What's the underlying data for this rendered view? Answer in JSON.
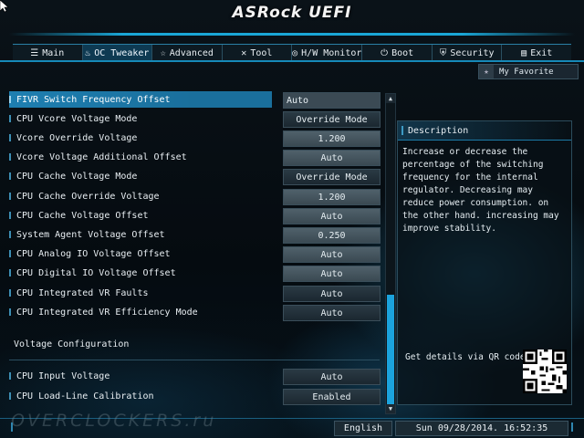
{
  "app": {
    "title": "ASRock UEFI"
  },
  "tabs": [
    {
      "label": "Main",
      "icon": "list-icon",
      "active": false
    },
    {
      "label": "OC Tweaker",
      "icon": "flame-icon",
      "active": true
    },
    {
      "label": "Advanced",
      "icon": "star-icon",
      "active": false
    },
    {
      "label": "Tool",
      "icon": "wrench-icon",
      "active": false
    },
    {
      "label": "H/W Monitor",
      "icon": "monitor-icon",
      "active": false
    },
    {
      "label": "Boot",
      "icon": "power-icon",
      "active": false
    },
    {
      "label": "Security",
      "icon": "shield-icon",
      "active": false
    },
    {
      "label": "Exit",
      "icon": "exit-icon",
      "active": false
    }
  ],
  "favorite": {
    "label": "My Favorite"
  },
  "settings": [
    {
      "label": "FIVR Switch Frequency Offset",
      "value": "Auto"
    },
    {
      "label": "CPU Vcore Voltage Mode",
      "value": "Override Mode"
    },
    {
      "label": "Vcore Override Voltage",
      "value": "1.200"
    },
    {
      "label": "Vcore Voltage Additional Offset",
      "value": "Auto"
    },
    {
      "label": "CPU Cache Voltage Mode",
      "value": "Override Mode"
    },
    {
      "label": "CPU Cache Override Voltage",
      "value": "1.200"
    },
    {
      "label": "CPU Cache Voltage Offset",
      "value": "Auto"
    },
    {
      "label": "System Agent Voltage Offset",
      "value": "0.250"
    },
    {
      "label": "CPU Analog IO Voltage Offset",
      "value": "Auto"
    },
    {
      "label": "CPU Digital IO Voltage Offset",
      "value": "Auto"
    },
    {
      "label": "CPU Integrated VR Faults",
      "value": "Auto"
    },
    {
      "label": "CPU Integrated VR Efficiency Mode",
      "value": "Auto"
    }
  ],
  "section": {
    "label": "Voltage Configuration"
  },
  "settings2": [
    {
      "label": "CPU Input Voltage",
      "value": "Auto"
    },
    {
      "label": "CPU Load-Line Calibration",
      "value": "Enabled"
    }
  ],
  "description": {
    "title": "Description",
    "text": "Increase or decrease the percentage of the switching frequency for the internal regulator. Decreasing may reduce power consumption. on the other hand. increasing may improve stability.",
    "qr_label": "Get details via QR code"
  },
  "footer": {
    "watermark": "OVERCLOCKERS.ru",
    "language": "English",
    "datetime": "Sun 09/28/2014. 16:52:35"
  },
  "colors": {
    "accent": "#1aa6d6",
    "selected": "#1e7fb1",
    "background": "#050b10"
  }
}
